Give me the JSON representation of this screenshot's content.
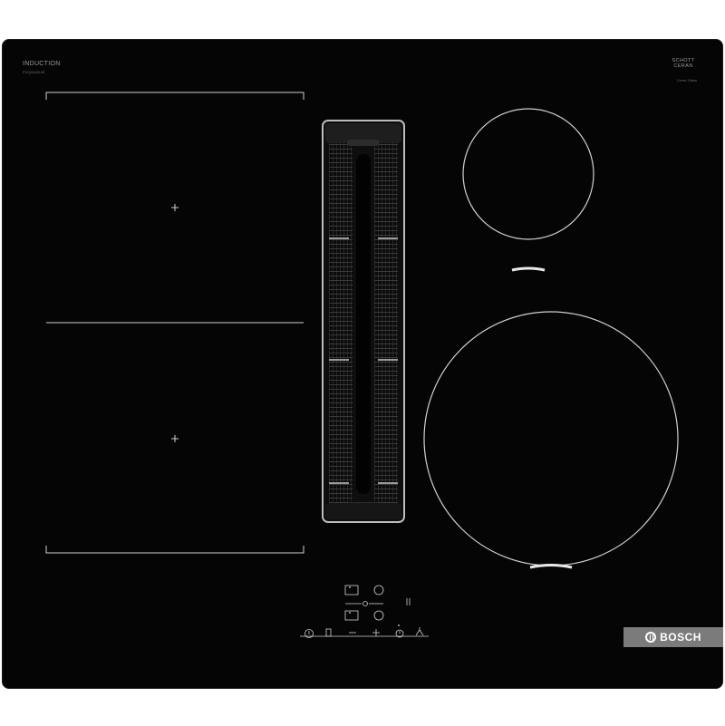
{
  "product": {
    "top_left_label": "INDUCTION",
    "top_left_sub": "PVQ611B16E",
    "top_right_logo_line1": "SCHOTT",
    "top_right_logo_line2": "CERAN",
    "top_right_sub": "Ceran Glass"
  },
  "brand": {
    "name": "BOSCH",
    "icon": "bosch-armature-icon"
  },
  "controls": {
    "labels": {
      "power": "power-icon",
      "hood": "hood-fan-icon",
      "minus": "–",
      "plus": "+",
      "timer": "timer-icon",
      "fan": "fan-icon",
      "flex_left": "flex-zone-icon"
    },
    "slider_label": "0  1  2  3  4  5  6  7  8  9"
  },
  "colors": {
    "glass": "#050505",
    "marking": "#bfbfbf",
    "accent": "#ffffff",
    "brand_badge": "#7b7b7b"
  }
}
